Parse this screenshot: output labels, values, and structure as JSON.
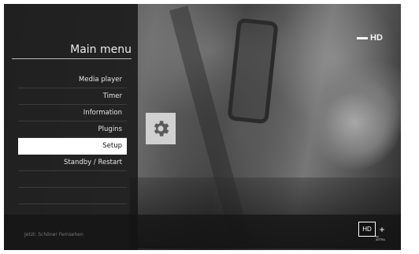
{
  "menu": {
    "title": "Main menu",
    "items": [
      {
        "label": "Media player",
        "selected": false
      },
      {
        "label": "Timer",
        "selected": false
      },
      {
        "label": "Information",
        "selected": false
      },
      {
        "label": "Plugins",
        "selected": false
      },
      {
        "label": "Setup",
        "selected": true
      },
      {
        "label": "Standby / Restart",
        "selected": false
      }
    ],
    "hint": "Jetzt: Schöner Fernsehen"
  },
  "selected_icon": "gear-icon",
  "channel_logo": {
    "text": "HD"
  },
  "badge": {
    "hd": "HD",
    "plus": "+",
    "sub": "by ASTRA"
  }
}
